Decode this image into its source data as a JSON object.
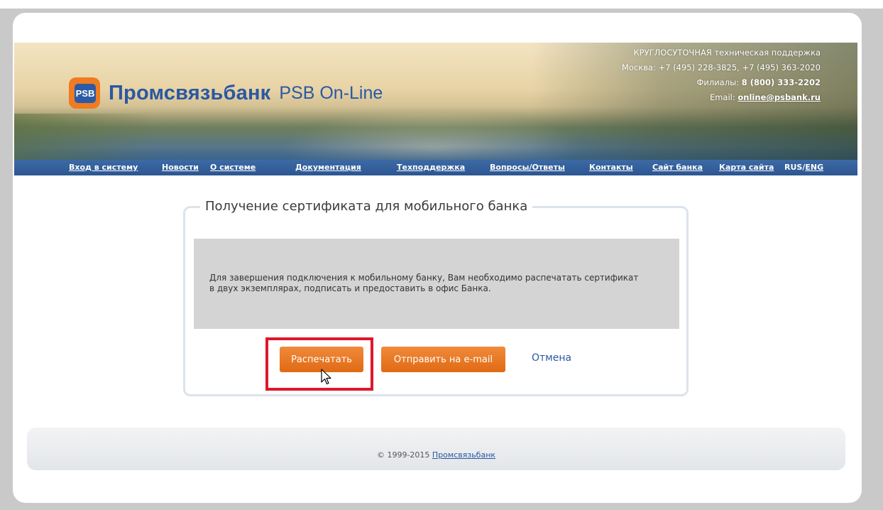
{
  "brand": {
    "logo_mark": "PSB",
    "name": "Промсвязьбанк",
    "product": "PSB On-Line"
  },
  "support": {
    "line1": "КРУГЛОСУТОЧНАЯ техническая поддержка",
    "line2": "Москва: +7 (495) 228-3825, +7 (495) 363-2020",
    "branches_label": "Филиалы:",
    "branches_phone": "8 (800) 333-2202",
    "email_label": "Email:",
    "email": "online@psbank.ru"
  },
  "nav": {
    "items": [
      "Вход в систему",
      "Новости",
      "О системе",
      "Документация",
      "Техподдержка",
      "Вопросы/Ответы",
      "Контакты",
      "Сайт банка",
      "Карта сайта"
    ],
    "lang_rus": "RUS",
    "lang_sep": "/",
    "lang_eng": "ENG"
  },
  "dialog": {
    "title": "Получение сертификата для мобильного банка",
    "message_line1": "Для завершения подключения к мобильному банку, Вам необходимо распечатать сертификат",
    "message_line2": "в двух экземплярах, подписать и предоставить в офис Банка.",
    "print_label": "Распечатать",
    "email_label": "Отправить на e-mail",
    "cancel_label": "Отмена"
  },
  "footer": {
    "copyright": "© 1999-2015",
    "link": "Промсвязьбанк"
  },
  "colors": {
    "brand_blue": "#2a58a3",
    "brand_orange": "#ef7b22",
    "highlight_red": "#e0162b",
    "nav_bg": "#2c5692"
  },
  "icons": [
    "mouse-pointer-icon"
  ]
}
